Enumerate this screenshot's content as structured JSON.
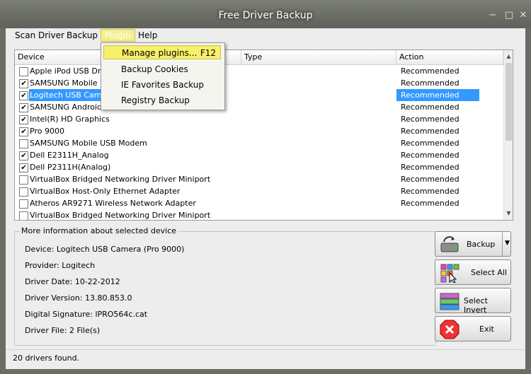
{
  "window": {
    "title": "Free Driver Backup",
    "minimize": "−",
    "maximize": "□",
    "close": "✕"
  },
  "menu": [
    "Scan Driver",
    "Backup",
    "Plugin",
    "Help"
  ],
  "dropdown": [
    {
      "label": "Manage plugins...",
      "shortcut": "F12",
      "highlighted": true
    },
    {
      "label": "Backup Cookies",
      "shortcut": ""
    },
    {
      "label": "IE Favorites Backup",
      "shortcut": ""
    },
    {
      "label": "Registry Backup",
      "shortcut": ""
    }
  ],
  "columns": {
    "device": "Device",
    "type": "Type",
    "action": "Action"
  },
  "rows": [
    {
      "device": "Apple iPod USB Driver",
      "checked": false,
      "action": "Recommended"
    },
    {
      "device": "SAMSUNG Mobile USB",
      "checked": true,
      "action": "Recommended"
    },
    {
      "device": "Logitech USB Camera",
      "checked": true,
      "action": "Recommended",
      "selected": true
    },
    {
      "device": "SAMSUNG Android ADB Interface",
      "checked": true,
      "action": "Recommended"
    },
    {
      "device": "Intel(R) HD Graphics",
      "checked": true,
      "action": "Recommended"
    },
    {
      "device": "Pro 9000",
      "checked": true,
      "action": "Recommended"
    },
    {
      "device": "SAMSUNG Mobile USB Modem",
      "checked": false,
      "action": "Recommended"
    },
    {
      "device": "Dell E2311H_Analog",
      "checked": true,
      "action": "Recommended"
    },
    {
      "device": "Dell P2311H(Analog)",
      "checked": true,
      "action": "Recommended"
    },
    {
      "device": "VirtualBox Bridged Networking Driver Miniport",
      "checked": false,
      "action": "Recommended"
    },
    {
      "device": "VirtualBox Host-Only Ethernet Adapter",
      "checked": false,
      "action": "Recommended"
    },
    {
      "device": "Atheros AR9271 Wireless Network Adapter",
      "checked": false,
      "action": "Recommended"
    },
    {
      "device": "VirtualBox Bridged Networking Driver Miniport",
      "checked": false,
      "action": ""
    }
  ],
  "info": {
    "title": "More information about selected device",
    "device": "Device:  Logitech USB Camera (Pro 9000)",
    "provider": "Provider: Logitech",
    "date": "Driver Date:  10-22-2012",
    "version": "Driver Version:  13.80.853.0",
    "signature": "Digital Signature: lPRO564c.cat",
    "file": "Driver File: 2 File(s)"
  },
  "buttons": {
    "backup": "Backup",
    "select_all": "Select All",
    "select_invert": "Select Invert",
    "exit": "Exit"
  },
  "status": "20 drivers found.",
  "colors": {
    "selection": "#3399ff",
    "menu_highlight": "#f7f16a"
  }
}
